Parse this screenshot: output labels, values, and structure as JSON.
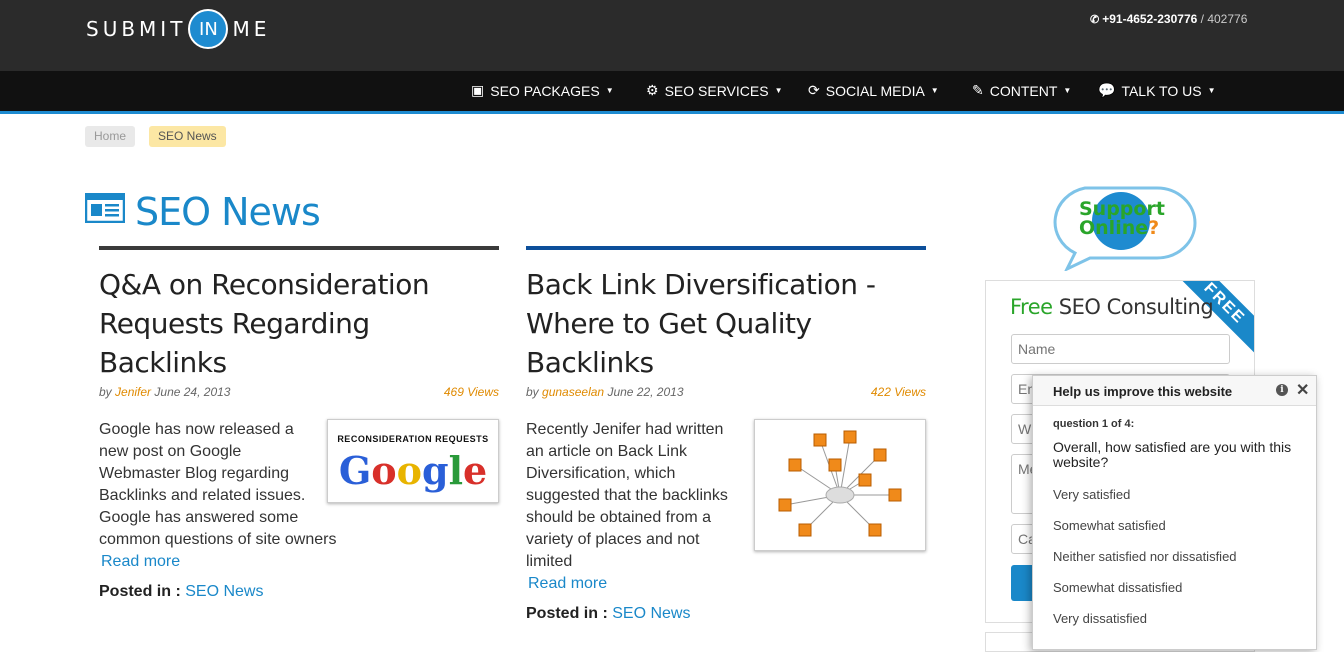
{
  "header": {
    "logo_left": "SUBMIT",
    "logo_mid": "IN",
    "logo_right": "ME",
    "phone_main": "+91-4652-230776",
    "phone_ext": "/ 402776"
  },
  "nav": [
    {
      "label": "SEO PACKAGES",
      "icon": "package-icon"
    },
    {
      "label": "SEO SERVICES",
      "icon": "search-gear-icon"
    },
    {
      "label": "SOCIAL MEDIA",
      "icon": "share-icon"
    },
    {
      "label": "CONTENT",
      "icon": "pencil-icon"
    },
    {
      "label": "TALK TO US",
      "icon": "chat-icon"
    }
  ],
  "breadcrumb": {
    "home": "Home",
    "current": "SEO News"
  },
  "page_title": "SEO News",
  "articles": [
    {
      "title_line1": "Q&A on Reconsideration",
      "title_line2": "Requests Regarding Backlinks",
      "by": "by",
      "author": "Jenifer",
      "date": "June 24, 2013",
      "views": "469 Views",
      "excerpt": "Google has now released a new post on Google Webmaster Blog regarding Backlinks and related issues.  Google has answered some common questions of site owners",
      "read_more": "Read more",
      "posted_label": "Posted in :",
      "category": "SEO News",
      "thumb_caption": "RECONSIDERATION REQUESTS",
      "thumb_word": "Google",
      "accent": "#3a3a3a"
    },
    {
      "title_line1": "Back Link Diversification -",
      "title_line2": "Where to Get Quality Backlinks",
      "by": "by",
      "author": "gunaseelan",
      "date": "June 22, 2013",
      "views": "422 Views",
      "excerpt": "Recently Jenifer had written an article on Back Link Diversification, which suggested that the backlinks should be obtained from a variety of places and not limited",
      "read_more": "Read more",
      "posted_label": "Posted in :",
      "category": "SEO News",
      "accent": "#0d4f9a"
    }
  ],
  "sidebar": {
    "support_line1": "Support",
    "support_line2": "Online",
    "support_mark": "?",
    "consult_free": "Free",
    "consult_rest": "SEO Consulting",
    "ribbon": "FREE",
    "fields": [
      {
        "placeholder": "Name"
      },
      {
        "placeholder": "En"
      },
      {
        "placeholder": "W"
      },
      {
        "placeholder": "Me"
      },
      {
        "placeholder": "Ca"
      }
    ]
  },
  "survey": {
    "title": "Help us improve this website",
    "info": "i",
    "close": "✕",
    "question_num": "question 1 of 4:",
    "question": "Overall, how satisfied are you with this website?",
    "options": [
      "Very satisfied",
      "Somewhat satisfied",
      "Neither satisfied nor dissatisfied",
      "Somewhat dissatisfied",
      "Very dissatisfied"
    ]
  },
  "colors": {
    "brand_blue": "#1a88c9",
    "orange": "#e08a00",
    "green": "#2aa52a"
  }
}
